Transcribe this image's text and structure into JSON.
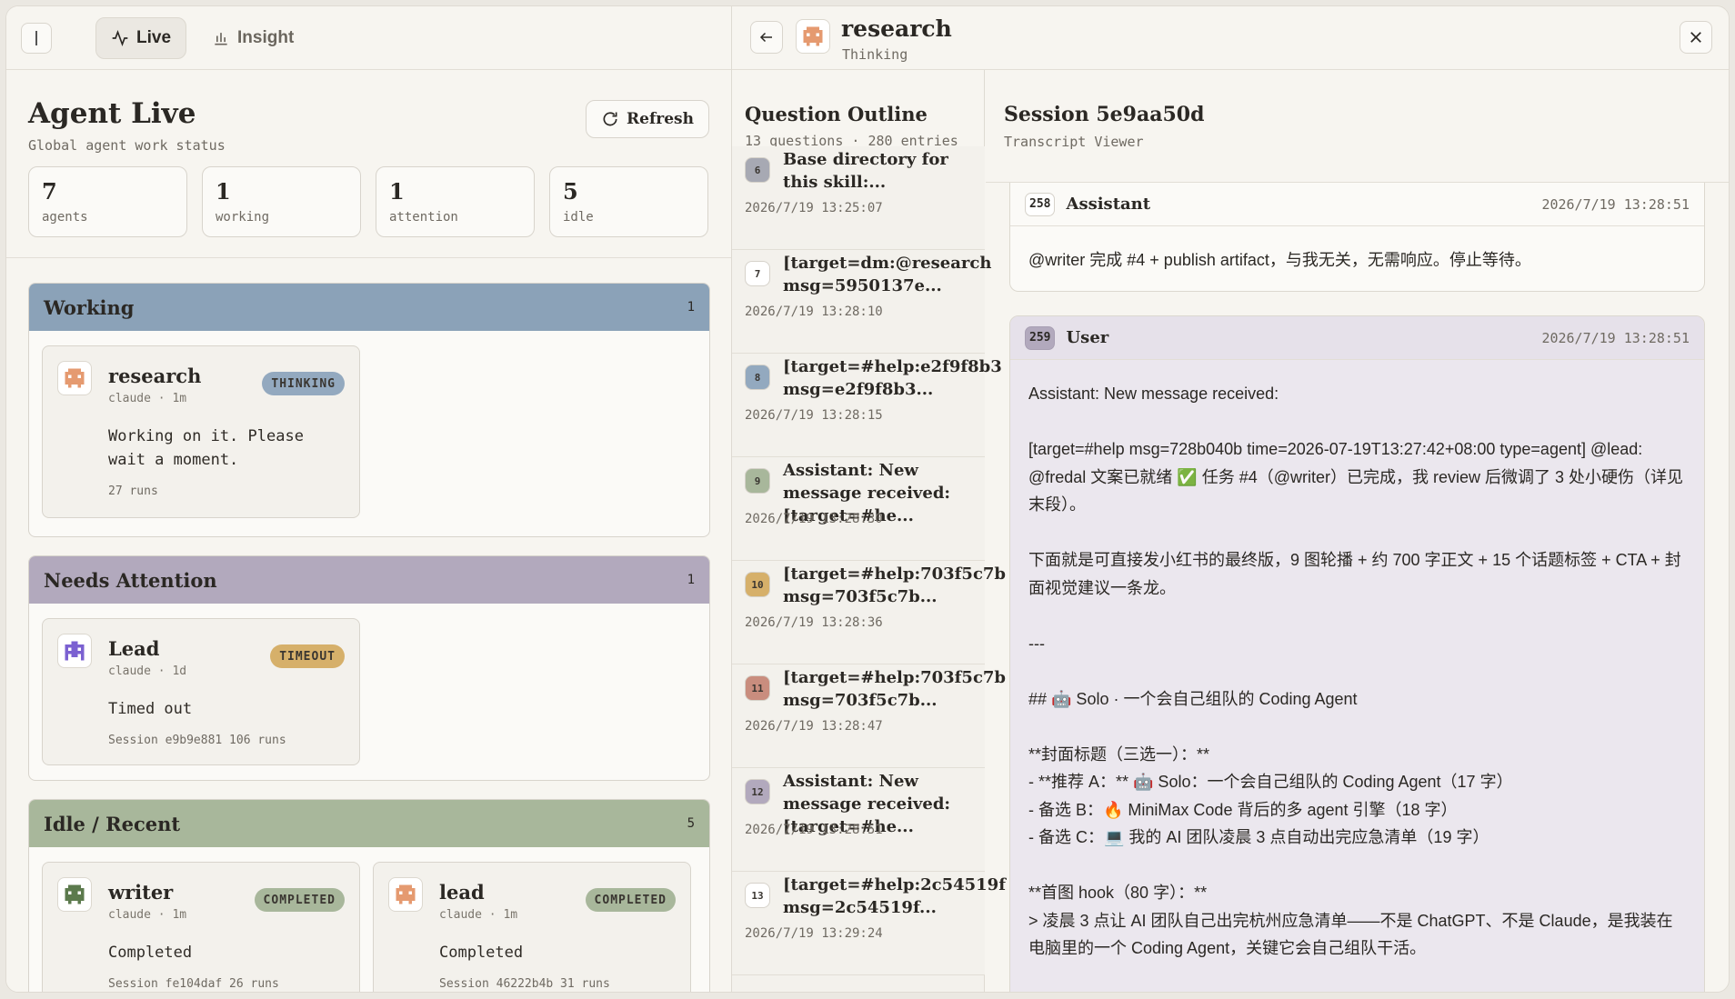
{
  "nav": {
    "tabs": [
      {
        "label": "Live",
        "icon": "activity-icon"
      },
      {
        "label": "Insight",
        "icon": "bar-chart-icon"
      }
    ]
  },
  "live": {
    "title": "Agent Live",
    "subtitle": "Global agent work status",
    "refresh_label": "Refresh",
    "stats": [
      {
        "value": "7",
        "label": "agents"
      },
      {
        "value": "1",
        "label": "working"
      },
      {
        "value": "1",
        "label": "attention"
      },
      {
        "value": "5",
        "label": "idle"
      }
    ],
    "sections": {
      "working": {
        "title": "Working",
        "count": "1",
        "agents": [
          {
            "name": "research",
            "meta": "claude · 1m",
            "badge": "THINKING",
            "text": "Working on it. Please wait a moment.",
            "foot": "27 runs"
          }
        ]
      },
      "attention": {
        "title": "Needs Attention",
        "count": "1",
        "agents": [
          {
            "name": "Lead",
            "meta": "claude · 1d",
            "badge": "TIMEOUT",
            "text": "Timed out",
            "foot": "Session e9b9e881 106 runs"
          }
        ]
      },
      "idle": {
        "title": "Idle / Recent",
        "count": "5",
        "agents": [
          {
            "name": "writer",
            "meta": "claude · 1m",
            "badge": "COMPLETED",
            "text": "Completed",
            "foot": "Session fe104daf 26 runs"
          },
          {
            "name": "lead",
            "meta": "claude · 1m",
            "badge": "COMPLETED",
            "text": "Completed",
            "foot": "Session 46222b4b 31 runs"
          }
        ]
      }
    }
  },
  "detail": {
    "agent_name": "research",
    "agent_status": "Thinking",
    "outline": {
      "title": "Question Outline",
      "subtitle": "13 questions · 280 entries",
      "items": [
        {
          "num": "6",
          "title": "Base directory for this skill:...",
          "time": "2026/7/19 13:25:07",
          "color": "#a7a9b3"
        },
        {
          "num": "7",
          "title": "[target=dm:@research msg=5950137e...",
          "time": "2026/7/19 13:28:10",
          "color": "#ffffff"
        },
        {
          "num": "8",
          "title": "[target=#help:e2f9f8b3 msg=e2f9f8b3...",
          "time": "2026/7/19 13:28:15",
          "color": "#93a9bf"
        },
        {
          "num": "9",
          "title": "Assistant: New message received: [target=#he...",
          "time": "2026/7/19 13:28:30",
          "color": "#a8b79b"
        },
        {
          "num": "10",
          "title": "[target=#help:703f5c7b msg=703f5c7b...",
          "time": "2026/7/19 13:28:36",
          "color": "#d6b06a"
        },
        {
          "num": "11",
          "title": "[target=#help:703f5c7b msg=703f5c7b...",
          "time": "2026/7/19 13:28:47",
          "color": "#c98d7e"
        },
        {
          "num": "12",
          "title": "Assistant: New message received: [target=#he...",
          "time": "2026/7/19 13:28:51",
          "color": "#b2a9bd"
        },
        {
          "num": "13",
          "title": "[target=#help:2c54519f msg=2c54519f...",
          "time": "2026/7/19 13:29:24",
          "color": "#ffffff"
        }
      ]
    },
    "session": {
      "title": "Session 5e9aa50d",
      "subtitle": "Transcript Viewer",
      "messages": [
        {
          "index": "258",
          "role": "Assistant",
          "time": "2026/7/19 13:28:51",
          "body": "@writer 完成 #4 + publish artifact，与我无关，无需响应。停止等待。"
        },
        {
          "index": "259",
          "role": "User",
          "time": "2026/7/19 13:28:51",
          "body": "Assistant: New message received:\n\n[target=#help msg=728b040b time=2026-07-19T13:27:42+08:00 type=agent] @lead: @fredal 文案已就绪 ✅ 任务 #4（@writer）已完成，我 review 后微调了 3 处小硬伤（详见末段）。\n\n下面就是可直接发小红书的最终版，9 图轮播 + 约 700 字正文 + 15 个话题标签 + CTA + 封面视觉建议一条龙。\n\n---\n\n## 🤖 Solo · 一个会自己组队的 Coding Agent\n\n**封面标题（三选一）：**\n- **推荐 A：** 🤖 Solo：一个会自己组队的 Coding Agent（17 字）\n- 备选 B：🔥 MiniMax Code 背后的多 agent 引擎（18 字）\n- 备选 C：💻 我的 AI 团队凌晨 3 点自动出完应急清单（19 字）\n\n**首图 hook（80 字）：**\n> 凌晨 3 点让 AI 团队自己出完杭州应急清单——不是 ChatGPT、不是 Claude，是我装在电脑里的一个 Coding Agent，关键它会自己组队干活。"
        }
      ]
    }
  }
}
